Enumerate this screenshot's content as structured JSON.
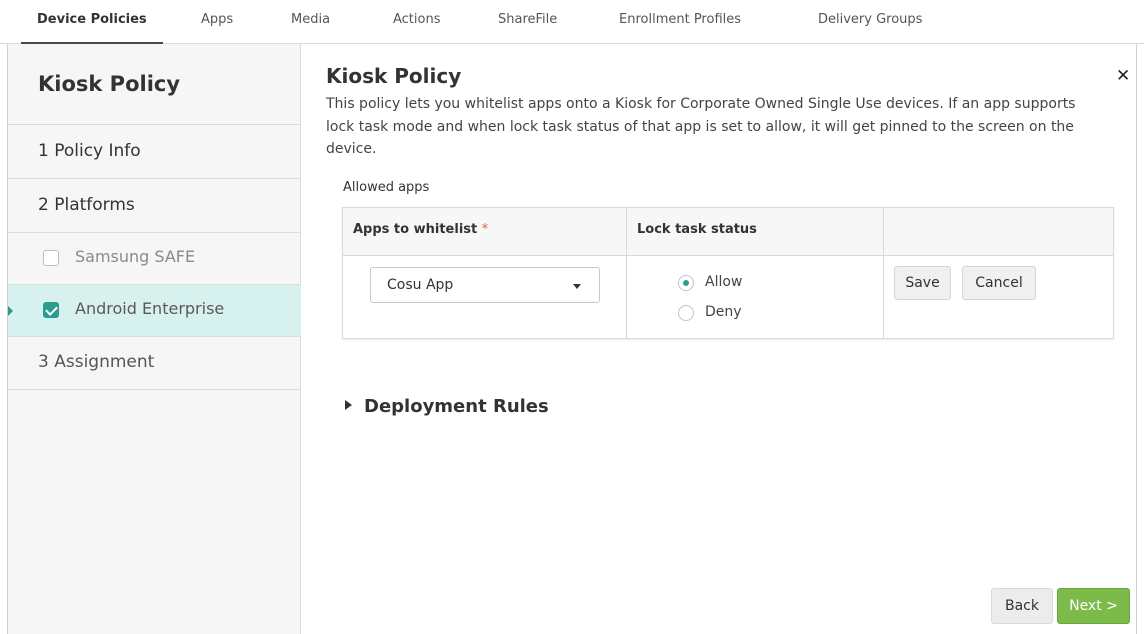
{
  "tabs": [
    {
      "label": "Device Policies",
      "active": true
    },
    {
      "label": "Apps"
    },
    {
      "label": "Media"
    },
    {
      "label": "Actions"
    },
    {
      "label": "ShareFile"
    },
    {
      "label": "Enrollment Profiles"
    },
    {
      "label": "Delivery Groups"
    }
  ],
  "sidebar": {
    "title": "Kiosk Policy",
    "steps": [
      {
        "label": "1  Policy Info"
      },
      {
        "label": "2  Platforms"
      },
      {
        "label": "3  Assignment"
      }
    ],
    "platforms": [
      {
        "label": "Samsung SAFE",
        "checked": false,
        "active": false
      },
      {
        "label": "Android Enterprise",
        "checked": true,
        "active": true
      }
    ]
  },
  "main": {
    "title": "Kiosk Policy",
    "description": "This policy lets you whitelist apps onto a Kiosk for Corporate Owned Single Use devices. If an app supports lock task mode and when lock task status of that app is set to allow, it will get pinned to the screen on the device.",
    "allowed_apps_label": "Allowed apps",
    "table": {
      "col_apps": "Apps to whitelist",
      "required_mark": "*",
      "col_lock": "Lock task status",
      "row": {
        "app": "Cosu App",
        "lock_options": [
          "Allow",
          "Deny"
        ],
        "lock_selected": "Allow",
        "save": "Save",
        "cancel": "Cancel"
      }
    },
    "deployment_rules": "Deployment Rules"
  },
  "footer": {
    "back": "Back",
    "next": "Next >"
  },
  "colors": {
    "accent": "#2a9d8f",
    "active_row": "#d6f1ee",
    "next_button": "#7cba4a",
    "required": "#e0623a"
  }
}
